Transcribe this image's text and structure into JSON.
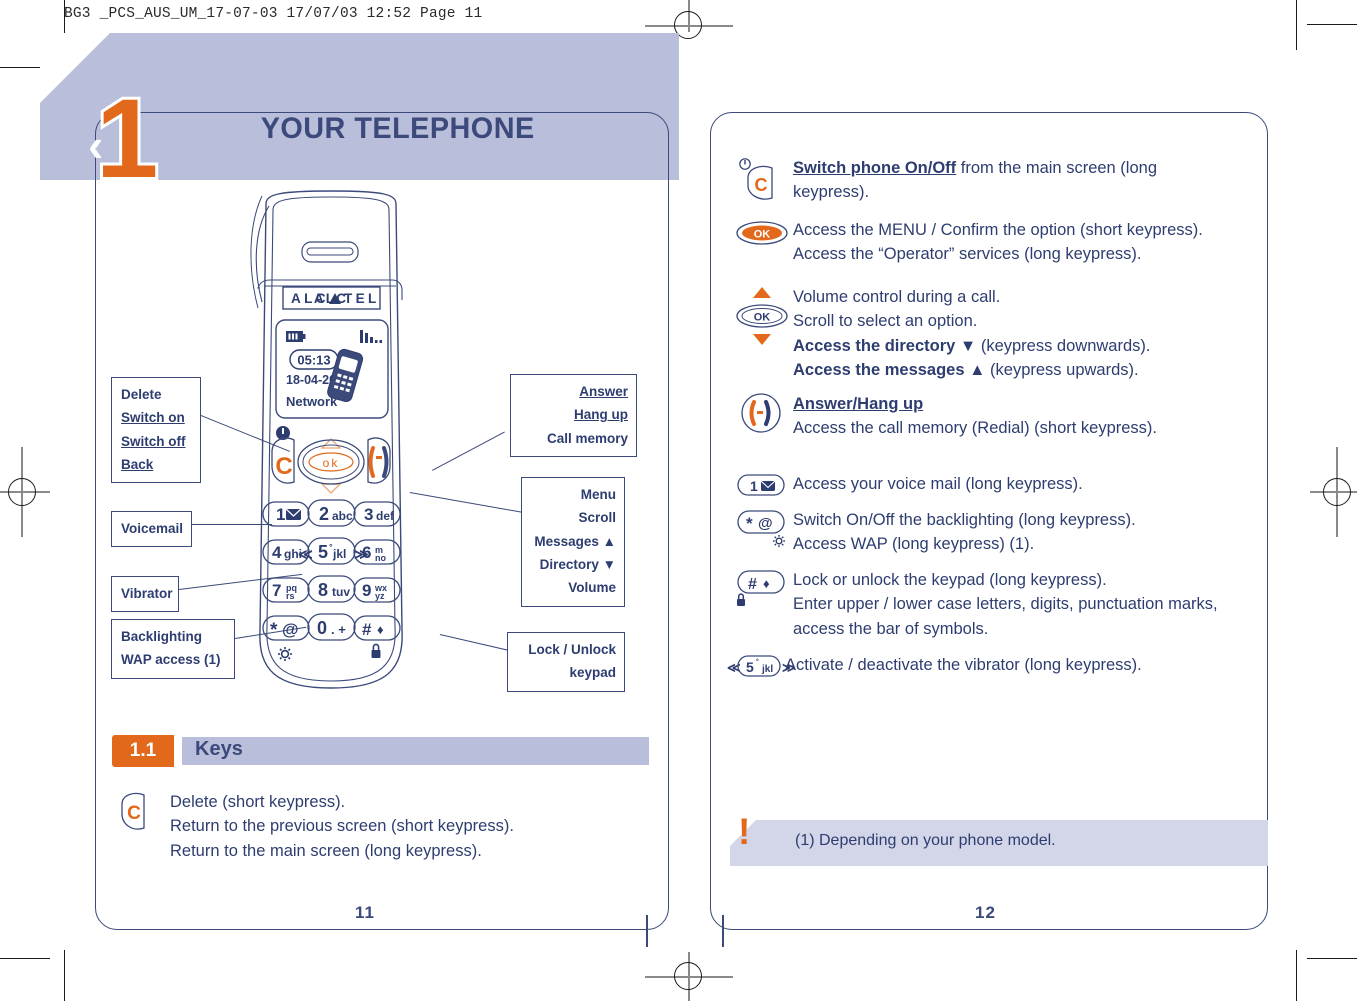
{
  "document": {
    "slug": "BG3 _PCS_AUS_UM_17-07-03  17/07/03  12:52  Page 11",
    "colors": {
      "band_lavender": "#b9bedb",
      "accent_orange": "#e2691c",
      "ink_blue": "#3b4a7a",
      "text_blue": "#2e3d70",
      "footnote_band": "#d2d6e8"
    }
  },
  "left_page": {
    "chapter_number": "1",
    "chapter_chevron": "‹",
    "chapter_title": "YOUR TELEPHONE",
    "folio": "11",
    "phone": {
      "brand": "ALCATEL",
      "screen": {
        "time": "05:13",
        "date": "18-04-2002",
        "network": "Network",
        "battery_icon": "battery-icon",
        "signal_icon": "signal-bars-icon",
        "handset_icon": "handset-graphic"
      },
      "soft_keys": {
        "power_icon": "power-icon",
        "clear_key": "C",
        "ok_key": "ok",
        "call_key": "call-handset-icon",
        "up_arrow": "△",
        "down_arrow": "▽"
      },
      "keypad": [
        {
          "digit": "1",
          "sub": "voicemail-icon",
          "sub_text": ""
        },
        {
          "digit": "2",
          "sub": "",
          "sub_text": "abc"
        },
        {
          "digit": "3",
          "sub": "",
          "sub_text": "def"
        },
        {
          "digit": "4",
          "sub": "",
          "sub_text": "ghi"
        },
        {
          "digit": "5",
          "sub": "",
          "sub_text": "jkl"
        },
        {
          "digit": "6",
          "sub": "",
          "sub_text": "mno"
        },
        {
          "digit": "7",
          "sub": "",
          "sub_text": "pqrs"
        },
        {
          "digit": "8",
          "sub": "",
          "sub_text": "tuv"
        },
        {
          "digit": "9",
          "sub": "",
          "sub_text": "wxyz"
        },
        {
          "digit": "*",
          "sub": "",
          "sub_text": "@"
        },
        {
          "digit": "0",
          "sub": "",
          "sub_text": ".+"
        },
        {
          "digit": "#",
          "sub": "",
          "sub_text": "♦"
        }
      ],
      "keypad_marks": {
        "backlight_icon": "sun-gear-icon",
        "lock_icon": "padlock-icon",
        "vibrate_left": "≪",
        "vibrate_right": "≫"
      }
    },
    "callouts": {
      "delete": {
        "lines": [
          "Delete",
          "Switch on",
          "Switch off",
          "Back"
        ]
      },
      "voicemail": {
        "lines": [
          "Voicemail"
        ]
      },
      "vibrator": {
        "lines": [
          "Vibrator"
        ]
      },
      "backlighting": {
        "lines": [
          "Backlighting",
          "WAP access (1)"
        ]
      },
      "answer": {
        "lines": [
          "Answer",
          "Hang up",
          "Call memory"
        ]
      },
      "menu": {
        "lines": [
          "Menu",
          "Scroll",
          "Messages ▲",
          "Directory ▼",
          "Volume"
        ]
      },
      "lock": {
        "lines": [
          "Lock / Unlock",
          "keypad"
        ]
      }
    },
    "section": {
      "number": "1.1",
      "title": "Keys",
      "entry": {
        "icon": "clear-key-icon",
        "lines": [
          "Delete (short keypress).",
          "Return to the previous screen (short keypress).",
          "Return to the main screen (long keypress)."
        ]
      }
    }
  },
  "right_page": {
    "folio": "12",
    "entries": [
      {
        "icon": "power-clear-key-icon",
        "lines": [
          {
            "bold_underline": "Switch phone On/Off",
            "rest": " from the main screen (long"
          },
          {
            "rest": "keypress)."
          }
        ]
      },
      {
        "icon": "ok-key-icon",
        "lines": [
          {
            "rest": "Access the MENU / Confirm the option (short keypress)."
          },
          {
            "rest": "Access the “Operator” services (long keypress)."
          }
        ]
      },
      {
        "icon": "ok-scroll-key-icon",
        "lines": [
          {
            "rest": "Volume control during a call."
          },
          {
            "rest": "Scroll to select an option."
          },
          {
            "bold": "Access the directory ▼",
            "rest": " (keypress downwards)."
          },
          {
            "bold": "Access the messages ▲",
            "rest": " (keypress upwards)."
          }
        ]
      },
      {
        "icon": "call-key-icon",
        "lines": [
          {
            "bold_underline": "Answer/Hang up",
            "rest": ""
          },
          {
            "rest": "Access the call memory (Redial) (short keypress)."
          }
        ]
      },
      {
        "icon": "key-1-icon",
        "lines": [
          {
            "rest": "Access your voice mail (long keypress)."
          }
        ]
      },
      {
        "icon": "star-key-icon",
        "lines": [
          {
            "rest": "Switch On/Off the backlighting (long keypress)."
          },
          {
            "rest": "Access WAP (long keypress) (1)."
          }
        ]
      },
      {
        "icon": "hash-key-icon",
        "lines": [
          {
            "rest": "Lock or unlock the keypad (long keypress)."
          },
          {
            "rest": "Enter upper / lower case letters, digits, punctuation marks,"
          },
          {
            "rest": "access the bar of symbols."
          }
        ]
      },
      {
        "icon": "key-5-vibrate-icon",
        "lines": [
          {
            "rest": "Activate / deactivate the vibrator (long keypress)."
          }
        ]
      }
    ],
    "footnote": {
      "marker": "!",
      "text": "(1)  Depending on your phone model."
    }
  }
}
